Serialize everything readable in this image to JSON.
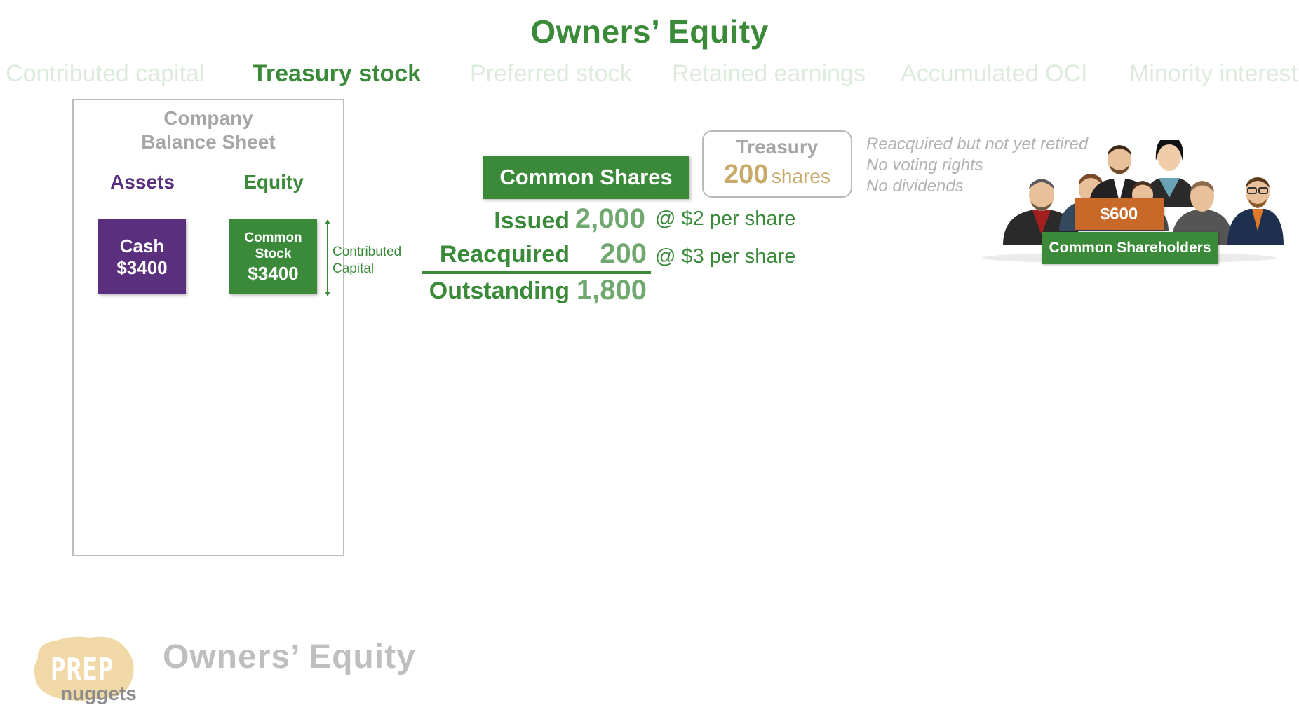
{
  "title": "Owners’ Equity",
  "tabs": [
    {
      "label": "Contributed capital",
      "active": false
    },
    {
      "label": "Treasury stock",
      "active": true
    },
    {
      "label": "Preferred stock",
      "active": false
    },
    {
      "label": "Retained earnings",
      "active": false
    },
    {
      "label": "Accumulated OCI",
      "active": false
    },
    {
      "label": "Minority interest",
      "active": false
    }
  ],
  "balance_sheet": {
    "title_line1": "Company",
    "title_line2": "Balance Sheet",
    "assets_header": "Assets",
    "equity_header": "Equity",
    "cash": {
      "label": "Cash",
      "amount": "$3400"
    },
    "common_stock": {
      "label_line1": "Common",
      "label_line2": "Stock",
      "amount": "$3400"
    },
    "bracket_label_line1": "Contributed",
    "bracket_label_line2": "Capital"
  },
  "common_shares": {
    "header": "Common Shares",
    "issued": {
      "label": "Issued",
      "value": "2,000",
      "note": "@ $2 per share"
    },
    "reacquired": {
      "label": "Reacquired",
      "value": "200",
      "note": "@ $3 per share"
    },
    "outstanding": {
      "label": "Outstanding",
      "value": "1,800"
    }
  },
  "treasury": {
    "title": "Treasury",
    "value": "200",
    "unit": "shares",
    "facts": [
      "Reacquired but not yet retired",
      "No voting rights",
      "No dividends"
    ]
  },
  "shareholders": {
    "amount": "$600",
    "label": "Common Shareholders"
  },
  "footer": {
    "logo_top": "PREP",
    "logo_bottom": "nuggets",
    "text": "Owners’ Equity"
  },
  "colors": {
    "green": "#3a8a3a",
    "light_green": "#70a870",
    "purple": "#5a2f7e",
    "gold": "#c8a96a",
    "orange": "#c8692a",
    "gray": "#a6a6a6",
    "faded_tab": "#dcebdc"
  }
}
